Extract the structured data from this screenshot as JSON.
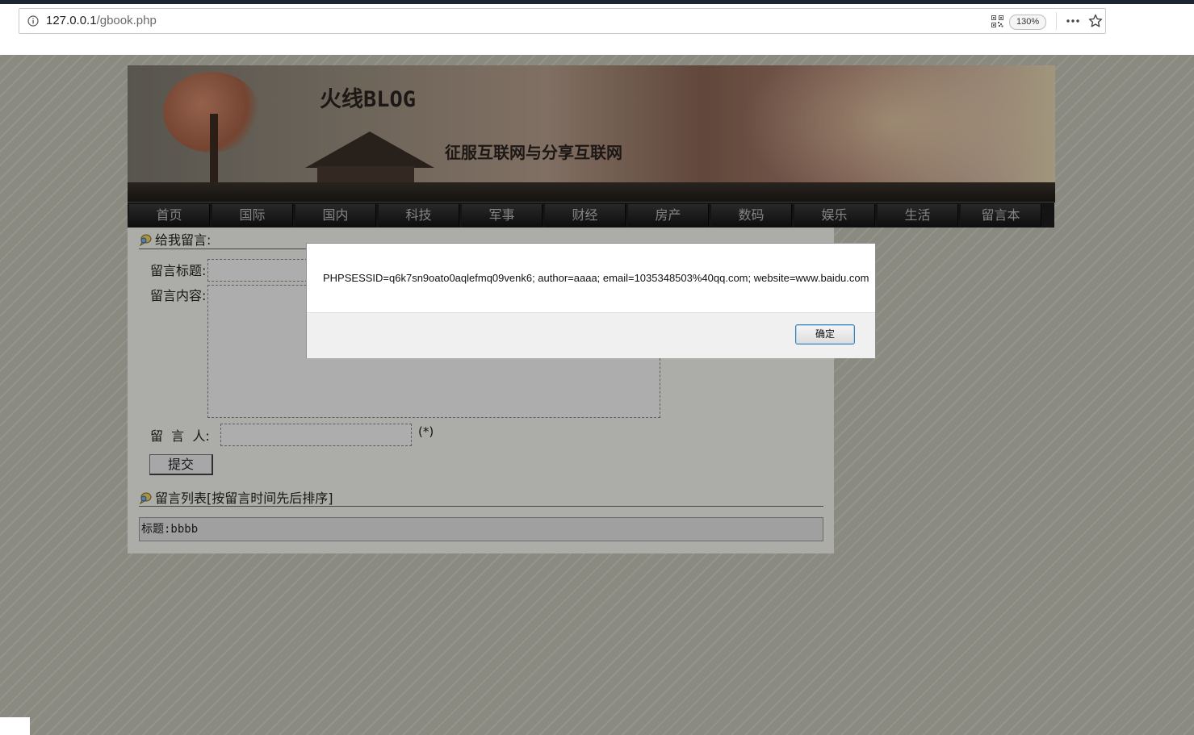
{
  "browser": {
    "url_host": "127.0.0.1",
    "url_path": "/gbook.php",
    "zoom": "130%"
  },
  "site": {
    "title": "火线BLOG",
    "subtitle": "征服互联网与分享互联网"
  },
  "nav": {
    "items": [
      "首页",
      "国际",
      "国内",
      "科技",
      "军事",
      "财经",
      "房产",
      "数码",
      "娱乐",
      "生活",
      "留言本"
    ]
  },
  "form": {
    "section_title": "给我留言:",
    "title_label": "留言标题:",
    "content_label": "留言内容:",
    "author_label": "留  言  人:",
    "required_mark": "(*)",
    "submit_label": "提交"
  },
  "list": {
    "section_title": "留言列表[按留言时间先后排序]",
    "entries": [
      "标题:bbbb"
    ]
  },
  "dialog": {
    "message": "PHPSESSID=q6k7sn9oato0aqlefmq09venk6; author=aaaa; email=1035348503%40qq.com; website=www.baidu.com",
    "ok_label": "确定"
  }
}
